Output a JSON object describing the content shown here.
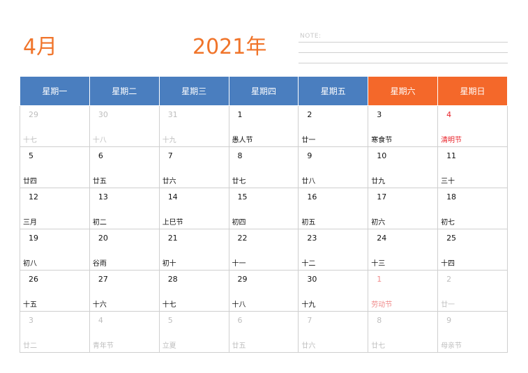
{
  "header": {
    "month": "4月",
    "year": "2021年",
    "note_label": "NOTE:"
  },
  "weekdays": [
    "星期一",
    "星期二",
    "星期三",
    "星期四",
    "星期五",
    "星期六",
    "星期日"
  ],
  "colors": {
    "weekday_header": "#4a7ebf",
    "weekend_header": "#f4682a",
    "title": "#f0742a",
    "holiday": "#e8232a"
  },
  "weeks": [
    [
      {
        "day": "29",
        "lunar": "十七",
        "state": "other"
      },
      {
        "day": "30",
        "lunar": "十八",
        "state": "other"
      },
      {
        "day": "31",
        "lunar": "十九",
        "state": "other"
      },
      {
        "day": "1",
        "lunar": "愚人节",
        "state": "normal"
      },
      {
        "day": "2",
        "lunar": "廿一",
        "state": "normal"
      },
      {
        "day": "3",
        "lunar": "寒食节",
        "state": "normal"
      },
      {
        "day": "4",
        "lunar": "清明节",
        "state": "red"
      }
    ],
    [
      {
        "day": "5",
        "lunar": "廿四",
        "state": "normal"
      },
      {
        "day": "6",
        "lunar": "廿五",
        "state": "normal"
      },
      {
        "day": "7",
        "lunar": "廿六",
        "state": "normal"
      },
      {
        "day": "8",
        "lunar": "廿七",
        "state": "normal"
      },
      {
        "day": "9",
        "lunar": "廿八",
        "state": "normal"
      },
      {
        "day": "10",
        "lunar": "廿九",
        "state": "normal"
      },
      {
        "day": "11",
        "lunar": "三十",
        "state": "normal"
      }
    ],
    [
      {
        "day": "12",
        "lunar": "三月",
        "state": "normal"
      },
      {
        "day": "13",
        "lunar": "初二",
        "state": "normal"
      },
      {
        "day": "14",
        "lunar": "上巳节",
        "state": "normal"
      },
      {
        "day": "15",
        "lunar": "初四",
        "state": "normal"
      },
      {
        "day": "16",
        "lunar": "初五",
        "state": "normal"
      },
      {
        "day": "17",
        "lunar": "初六",
        "state": "normal"
      },
      {
        "day": "18",
        "lunar": "初七",
        "state": "normal"
      }
    ],
    [
      {
        "day": "19",
        "lunar": "初八",
        "state": "normal"
      },
      {
        "day": "20",
        "lunar": "谷雨",
        "state": "normal"
      },
      {
        "day": "21",
        "lunar": "初十",
        "state": "normal"
      },
      {
        "day": "22",
        "lunar": "十一",
        "state": "normal"
      },
      {
        "day": "23",
        "lunar": "十二",
        "state": "normal"
      },
      {
        "day": "24",
        "lunar": "十三",
        "state": "normal"
      },
      {
        "day": "25",
        "lunar": "十四",
        "state": "normal"
      }
    ],
    [
      {
        "day": "26",
        "lunar": "十五",
        "state": "normal"
      },
      {
        "day": "27",
        "lunar": "十六",
        "state": "normal"
      },
      {
        "day": "28",
        "lunar": "十七",
        "state": "normal"
      },
      {
        "day": "29",
        "lunar": "十八",
        "state": "normal"
      },
      {
        "day": "30",
        "lunar": "十九",
        "state": "normal"
      },
      {
        "day": "1",
        "lunar": "劳动节",
        "state": "red-light"
      },
      {
        "day": "2",
        "lunar": "廿一",
        "state": "other"
      }
    ],
    [
      {
        "day": "3",
        "lunar": "廿二",
        "state": "other"
      },
      {
        "day": "4",
        "lunar": "青年节",
        "state": "other"
      },
      {
        "day": "5",
        "lunar": "立夏",
        "state": "other"
      },
      {
        "day": "6",
        "lunar": "廿五",
        "state": "other"
      },
      {
        "day": "7",
        "lunar": "廿六",
        "state": "other"
      },
      {
        "day": "8",
        "lunar": "廿七",
        "state": "other"
      },
      {
        "day": "9",
        "lunar": "母亲节",
        "state": "other"
      }
    ]
  ]
}
